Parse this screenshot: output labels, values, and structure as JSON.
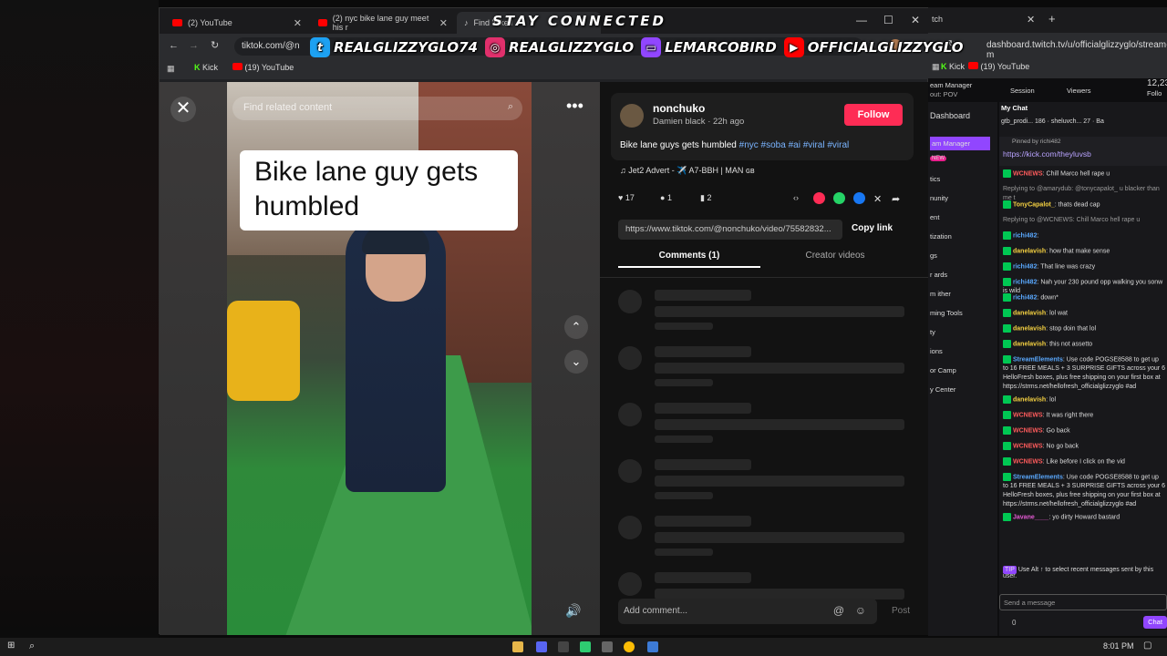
{
  "overlay": {
    "title": "STAY CONNECTED",
    "socials": [
      {
        "icon": "twitter-icon",
        "handle": "REALGLIZZYGLO74",
        "color": "#1da1f2"
      },
      {
        "icon": "instagram-icon",
        "handle": "REALGLIZZYGLO",
        "color": "#e1306c"
      },
      {
        "icon": "twitch-icon",
        "handle": "LEMARCOBIRD",
        "color": "#9146ff"
      },
      {
        "icon": "youtube-icon",
        "handle": "OFFICIALGLIZZYGLO",
        "color": "#ff0000"
      }
    ]
  },
  "browser": {
    "tabs": [
      {
        "label": "(2) YouTube"
      },
      {
        "label": "(2) nyc bike lane guy meet his r"
      },
      {
        "label": "Find 'bike l"
      }
    ],
    "url": "tiktok.com/@n",
    "bookmarks": [
      {
        "label": "Kick"
      },
      {
        "label": "(19) YouTube"
      }
    ]
  },
  "video": {
    "search_placeholder": "Find related content",
    "caption_line1": "Bike lane guy gets",
    "caption_line2": "humbled"
  },
  "post": {
    "username": "nonchuko",
    "subtitle": "Damien black · 22h ago",
    "follow_label": "Follow",
    "description": "Bike lane guys gets humbled ",
    "hashtags": "#nyc #soba #ai #viral #viral",
    "music": "Jet2 Advert - ✈️ A7-BBH | MAN ɢʙ",
    "likes": "17",
    "comments": "1",
    "saves": "2",
    "link": "https://www.tiktok.com/@nonchuko/video/75582832...",
    "copy_label": "Copy link",
    "tab_comments": "Comments (1)",
    "tab_creator": "Creator videos",
    "add_comment_placeholder": "Add comment...",
    "post_label": "Post"
  },
  "twitch": {
    "tab_label": "tch",
    "url": "dashboard.twitch.tv/u/officialglizzyglo/stream-m",
    "bookmarks": [
      {
        "label": "Kick"
      },
      {
        "label": "(19) YouTube"
      }
    ],
    "header": {
      "stream_manager": "eam Manager",
      "sub": "out: POV",
      "session": "Session",
      "viewers": "Viewers",
      "count": "12,23",
      "followers": "Follo"
    },
    "sidebar": {
      "dashboard": "Dashboard",
      "items": [
        "am Manager",
        "NEW",
        "tics",
        "nunity",
        "ent",
        "tization",
        "gs",
        "r ards",
        "m ither",
        "ming Tools",
        "ty",
        "ions",
        "or Camp",
        "y Center"
      ]
    },
    "chat": {
      "title": "My Chat",
      "top_bar": "gtb_prodi... 186 · sheluvch... 27 · Ba",
      "pinned_by": "Pinned by richi482",
      "pinned_link": "https://kick.com/theyluvsb",
      "messages": [
        {
          "name": "WCNEWS",
          "text": ": Chill Marco hell rape u",
          "color": "#ff5c5c"
        },
        {
          "name": "",
          "text": "Replying to @amarydub: @tonycapalot_ u blacker than me t",
          "color": "#aaa"
        },
        {
          "name": "TonyCapalot_",
          "text": ": thats dead cap",
          "color": "#f5d142"
        },
        {
          "name": "",
          "text": "Replying to @WCNEWS: Chill Marco hell rape u",
          "color": "#aaa"
        },
        {
          "name": "richi482",
          "text": ":",
          "color": "#5aa9ff"
        },
        {
          "name": "danelavish",
          "text": ": how that make sense",
          "color": "#f5d142"
        },
        {
          "name": "richi482",
          "text": ": That line was crazy",
          "color": "#5aa9ff"
        },
        {
          "name": "richi482",
          "text": ": Nah your 230 pound opp walking you sonw is wild",
          "color": "#5aa9ff"
        },
        {
          "name": "richi482",
          "text": ": down*",
          "color": "#5aa9ff"
        },
        {
          "name": "danelavish",
          "text": ": lol wat",
          "color": "#f5d142"
        },
        {
          "name": "danelavish",
          "text": ": stop doin that lol",
          "color": "#f5d142"
        },
        {
          "name": "danelavish",
          "text": ": this not assetto",
          "color": "#f5d142"
        },
        {
          "name": "StreamElements",
          "text": ": Use code POGSE8588 to get up to 16 FREE MEALS + 3 SURPRISE GIFTS across your 6 HelloFresh boxes, plus free shipping on your first box at https://strms.net/hellofresh_officialglizzyglo #ad",
          "color": "#5aa9ff"
        },
        {
          "name": "danelavish",
          "text": ": lol",
          "color": "#f5d142"
        },
        {
          "name": "WCNEWS",
          "text": ": It was right there",
          "color": "#ff5c5c"
        },
        {
          "name": "WCNEWS",
          "text": ": Go back",
          "color": "#ff5c5c"
        },
        {
          "name": "WCNEWS",
          "text": ": No go back",
          "color": "#ff5c5c"
        },
        {
          "name": "WCNEWS",
          "text": ": Like before I click on the vid",
          "color": "#ff5c5c"
        },
        {
          "name": "StreamElements",
          "text": ": Use code POGSE8588 to get up to 16 FREE MEALS + 3 SURPRISE GIFTS across your 6 HelloFresh boxes, plus free shipping on your first box at https://strms.net/hellofresh_officialglizzyglo #ad",
          "color": "#5aa9ff"
        },
        {
          "name": "Javane____",
          "text": ": yo dirty Howard bastard",
          "color": "#e55bd5"
        }
      ],
      "tip": "Use  Alt  ↑  to select recent messages sent by this user.",
      "input_placeholder": "Send a message",
      "chat_button": "Chat",
      "points": "0"
    }
  },
  "taskbar": {
    "time": "8:01 PM"
  }
}
